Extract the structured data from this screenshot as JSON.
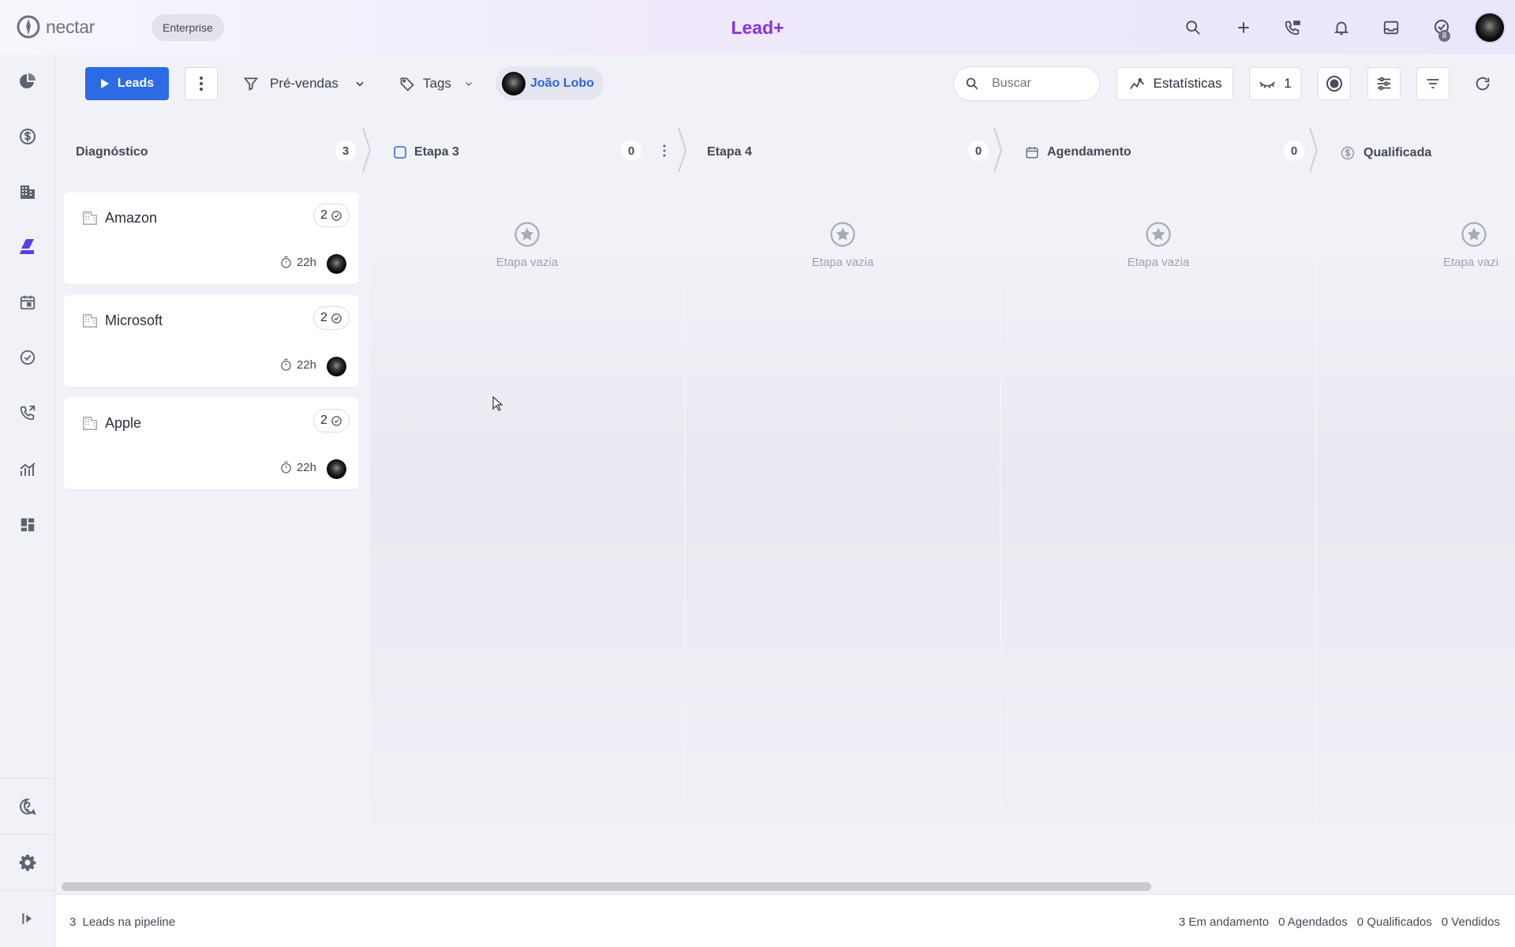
{
  "header": {
    "logo_text": "nectar",
    "plan_badge": "Enterprise",
    "app_title": "Lead+",
    "tasks_count": "8",
    "icons": [
      "search-icon",
      "plus-icon",
      "phone-icon",
      "bell-icon",
      "inbox-icon",
      "tasks-icon"
    ]
  },
  "sidebar": {
    "items": [
      "dashboard-icon",
      "deals-icon",
      "companies-icon",
      "leads-icon",
      "calendar-icon",
      "tasks-icon",
      "calls-icon",
      "reports-icon",
      "apps-icon"
    ],
    "bottom": [
      "help-icon",
      "settings-icon",
      "expand-icon"
    ]
  },
  "toolbar": {
    "leads_button": "Leads",
    "pipeline_filter": "Pré-vendas",
    "tags_filter": "Tags",
    "user_chip": "João Lobo",
    "search_placeholder": "Buscar",
    "stats_button": "Estatísticas",
    "hidden_count": "1"
  },
  "stages": [
    {
      "name": "Diagnóstico",
      "count": "3",
      "icon": ""
    },
    {
      "name": "Etapa 3",
      "count": "0",
      "icon": "checkbox-icon"
    },
    {
      "name": "Etapa 4",
      "count": "0",
      "icon": ""
    },
    {
      "name": "Agendamento",
      "count": "0",
      "icon": "calendar-icon"
    },
    {
      "name": "Qualificada",
      "count": "",
      "icon": "dollar-icon"
    }
  ],
  "cards": [
    {
      "name": "Amazon",
      "tasks": "2",
      "time": "22h"
    },
    {
      "name": "Microsoft",
      "tasks": "2",
      "time": "22h"
    },
    {
      "name": "Apple",
      "tasks": "2",
      "time": "22h"
    }
  ],
  "empty_stage_label": "Etapa vazia",
  "empty_stage_label_clipped": "Etapa vazi",
  "footer": {
    "leads_count": "3",
    "leads_label": "Leads na pipeline",
    "in_progress": "3 Em andamento",
    "scheduled": "0 Agendados",
    "qualified": "0 Qualificados",
    "sold": "0 Vendidos"
  },
  "colors": {
    "accent_blue": "#2d6be4",
    "title_purple": "#8b2fe0",
    "leads_icon_purple": "#5b3ee0"
  }
}
